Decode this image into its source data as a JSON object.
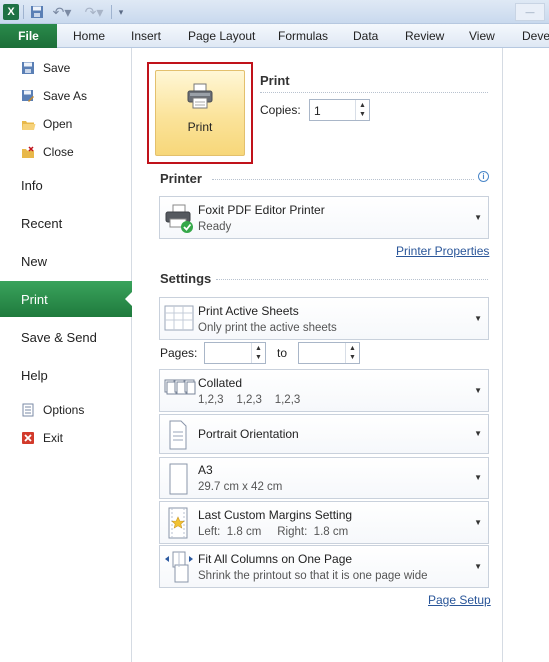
{
  "quick_access": {
    "logo_text": "X"
  },
  "tabs": [
    "Home",
    "Insert",
    "Page Layout",
    "Formulas",
    "Data",
    "Review",
    "View",
    "Devel"
  ],
  "file_tab": "File",
  "left_nav": {
    "save": "Save",
    "save_as": "Save As",
    "open": "Open",
    "close": "Close",
    "info": "Info",
    "recent": "Recent",
    "new": "New",
    "print": "Print",
    "save_send": "Save & Send",
    "help": "Help",
    "options": "Options",
    "exit": "Exit"
  },
  "print": {
    "heading": "Print",
    "button_label": "Print",
    "copies_label": "Copies:",
    "copies_value": "1"
  },
  "printer": {
    "heading": "Printer",
    "name": "Foxit PDF Editor Printer",
    "status": "Ready",
    "properties_link": "Printer Properties"
  },
  "settings": {
    "heading": "Settings",
    "print_what": {
      "title": "Print Active Sheets",
      "sub": "Only print the active sheets"
    },
    "pages_label": "Pages:",
    "to_label": "to",
    "collation": {
      "title": "Collated",
      "sub": "1,2,3    1,2,3    1,2,3"
    },
    "orientation": {
      "title": "Portrait Orientation"
    },
    "paper": {
      "title": "A3",
      "sub": "29.7 cm x 42 cm"
    },
    "margins": {
      "title": "Last Custom Margins Setting",
      "sub": "Left:  1.8 cm     Right:  1.8 cm"
    },
    "scaling": {
      "title": "Fit All Columns on One Page",
      "sub": "Shrink the printout so that it is one page wide"
    },
    "page_setup_link": "Page Setup"
  },
  "colors": {
    "file_tab": "#1f7a3d",
    "highlight_border": "#c0121a",
    "link": "#2a5699"
  }
}
